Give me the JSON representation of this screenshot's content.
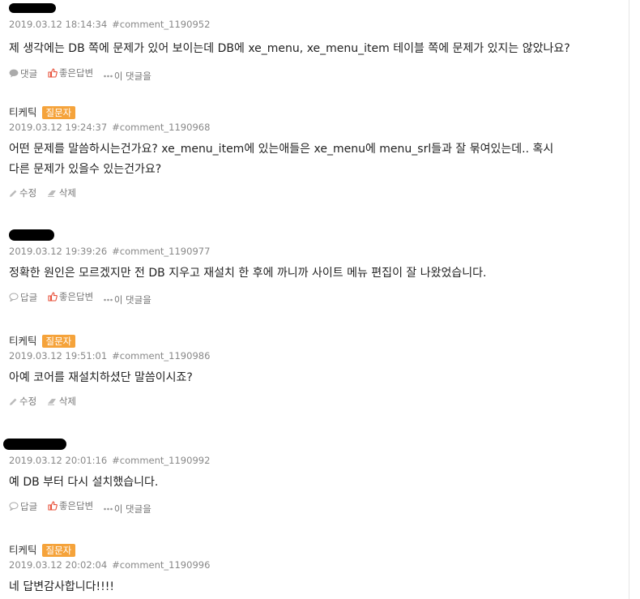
{
  "comments": [
    {
      "author": "",
      "is_op": false,
      "badge": "",
      "date": "2019.03.12 18:14:34",
      "id": "#comment_1190952",
      "lines": [
        "제 생각에는 DB 쪽에 문제가 있어 보이는데 DB에 xe_menu, xe_menu_item 테이블 쪽에 문제가 있지는 않았나요?"
      ],
      "actions": [
        "댓글",
        "좋은답변",
        "이 댓글을"
      ]
    },
    {
      "author": "티케틱",
      "is_op": true,
      "badge": "질문자",
      "date": "2019.03.12 19:24:37",
      "id": "#comment_1190968",
      "lines": [
        "어떤 문제를 말씀하시는건가요? xe_menu_item에 있는애들은 xe_menu에 menu_srl들과 잘 묶여있는데.. 혹시",
        "다른 문제가 있을수 있는건가요?"
      ],
      "actions": [
        "수정",
        "삭제"
      ]
    },
    {
      "author": "",
      "is_op": false,
      "badge": "",
      "date": "2019.03.12 19:39:26",
      "id": "#comment_1190977",
      "lines": [
        "정확한 원인은 모르겠지만 전 DB 지우고 재설치 한 후에 까니까 사이트 메뉴 편집이 잘 나왔었습니다."
      ],
      "actions": [
        "답글",
        "좋은답변",
        "이 댓글을"
      ]
    },
    {
      "author": "티케틱",
      "is_op": true,
      "badge": "질문자",
      "date": "2019.03.12 19:51:01",
      "id": "#comment_1190986",
      "lines": [
        "아예 코어를 재설치하셨단 말씀이시죠?"
      ],
      "actions": [
        "수정",
        "삭제"
      ]
    },
    {
      "author": "",
      "is_op": false,
      "badge": "",
      "date": "2019.03.12 20:01:16",
      "id": "#comment_1190992",
      "lines": [
        "예 DB 부터 다시 설치했습니다."
      ],
      "actions": [
        "답글",
        "좋은답변",
        "이 댓글을"
      ]
    },
    {
      "author": "티케틱",
      "is_op": true,
      "badge": "질문자",
      "date": "2019.03.12 20:02:04",
      "id": "#comment_1190996",
      "lines": [
        "네 답변감사합니다!!!!"
      ],
      "actions": []
    }
  ],
  "colors": {
    "badge": "#f5a33b",
    "like_icon": "#e8503a",
    "meta": "#888888"
  }
}
